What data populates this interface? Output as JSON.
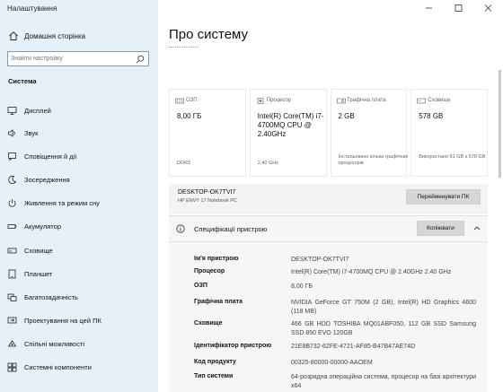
{
  "window": {
    "title": "Налаштування"
  },
  "nav": {
    "home_label": "Домашня сторінка",
    "search_placeholder": "Знайти настройку",
    "section_title": "Система",
    "items": [
      {
        "label": "Дисплей",
        "icon": "monitor-icon"
      },
      {
        "label": "Звук",
        "icon": "speaker-icon"
      },
      {
        "label": "Сповіщення й дії",
        "icon": "notification-icon"
      },
      {
        "label": "Зосередження",
        "icon": "moon-icon"
      },
      {
        "label": "Живлення та режим сну",
        "icon": "power-icon"
      },
      {
        "label": "Акумулятор",
        "icon": "battery-icon"
      },
      {
        "label": "Сховище",
        "icon": "storage-icon"
      },
      {
        "label": "Планшет",
        "icon": "tablet-icon"
      },
      {
        "label": "Багатозадачність",
        "icon": "multitask-icon"
      },
      {
        "label": "Проектування на цей ПК",
        "icon": "project-icon"
      },
      {
        "label": "Спільні можливості",
        "icon": "shared-icon"
      },
      {
        "label": "Системні компоненти",
        "icon": "components-icon"
      }
    ]
  },
  "page": {
    "title": "Про систему",
    "tiles": [
      {
        "label": "ОЗП",
        "value": "8,00 ГБ",
        "footer": "DDR3"
      },
      {
        "label": "Процесор",
        "value": "Intel(R) Core(TM) i7-4700MQ CPU @ 2.40GHz",
        "footer": "2,40 GHz"
      },
      {
        "label": "Графічна плата",
        "value": "2 GB",
        "footer": "Інстальовано кілька графічних процесорів"
      },
      {
        "label": "Сховище",
        "value": "578 GB",
        "footer": "Використано 91 GB з 578 GB"
      }
    ],
    "device": {
      "name": "DESKTOP-OK7TVI7",
      "model": "HP ENVY 17 Notebook PC",
      "rename_label": "Перейменувати ПК"
    },
    "specs": {
      "title": "Специфікації пристрою",
      "copy_label": "Копіювати",
      "rows": [
        {
          "key": "Ім'я пристрою",
          "value": "DESKTOP-OK7TVI7"
        },
        {
          "key": "Процесор",
          "value": "Intel(R) Core(TM) i7-4700MQ CPU @ 2.40GHz 2.40 GHz"
        },
        {
          "key": "ОЗП",
          "value": "8,00 ГБ"
        },
        {
          "key": "Графічна плата",
          "value": "NVIDIA GeForce GT 750M (2 GB), Intel(R) HD Graphics 4600 (118 MB)"
        },
        {
          "key": "Сховище",
          "value": "466 GB HDD TOSHIBA MQ01ABF050, 112 GB SSD Samsung SSD 850 EVO 120GB"
        },
        {
          "key": "Ідентифікатор пристрою",
          "value": "21E8B732-62FE-4721-AF85-B47B47AE74D"
        },
        {
          "key": "Код продукту",
          "value": "00325-80000-00000-AAOEM"
        },
        {
          "key": "Тип системи",
          "value": "64-розрядна операційна система, процесор на базі архітектури x64"
        }
      ]
    }
  },
  "colors": {
    "nav_bg": "#e6f0f8",
    "accent": "#0067c0"
  }
}
